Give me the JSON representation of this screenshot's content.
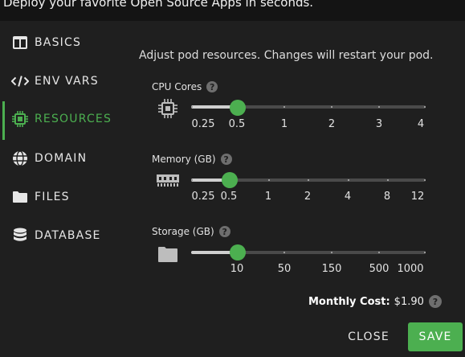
{
  "header": {
    "tagline": "Deploy your favorite Open Source Apps in seconds."
  },
  "sidebar": {
    "items": [
      {
        "label": "BASICS",
        "icon": "basics-icon",
        "active": false
      },
      {
        "label": "ENV VARS",
        "icon": "code-icon",
        "active": false
      },
      {
        "label": "RESOURCES",
        "icon": "chip-icon",
        "active": true
      },
      {
        "label": "DOMAIN",
        "icon": "globe-icon",
        "active": false
      },
      {
        "label": "FILES",
        "icon": "folder-icon",
        "active": false
      },
      {
        "label": "DATABASE",
        "icon": "database-icon",
        "active": false
      }
    ]
  },
  "resources": {
    "intro": "Adjust pod resources. Changes will restart your pod.",
    "cpu": {
      "label": "CPU Cores",
      "help": "?",
      "ticks": [
        "0.25",
        "0.5",
        "1",
        "2",
        "3",
        "4"
      ],
      "selected": "0.5"
    },
    "memory": {
      "label": "Memory (GB)",
      "help": "?",
      "ticks": [
        "0.25",
        "0.5",
        "1",
        "2",
        "4",
        "8",
        "12"
      ],
      "selected": "0.5"
    },
    "storage": {
      "label": "Storage (GB)",
      "help": "?",
      "ticks": [
        "10",
        "50",
        "150",
        "500",
        "1000"
      ],
      "selected": "10"
    }
  },
  "footer": {
    "cost_label": "Monthly Cost:",
    "cost_value": "$1.90",
    "cost_help": "?",
    "close_label": "CLOSE",
    "save_label": "SAVE"
  },
  "colors": {
    "accent": "#4caf50",
    "background": "#1f1f1f"
  }
}
